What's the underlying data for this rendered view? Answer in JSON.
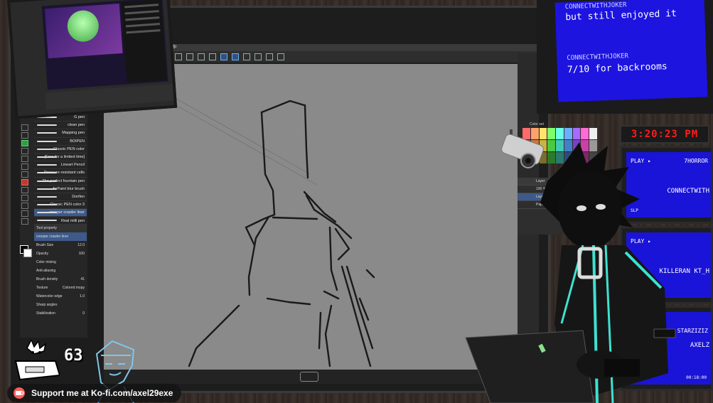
{
  "app": {
    "menu_help": "Help"
  },
  "brushes": [
    {
      "label": "G pen"
    },
    {
      "label": "clean pen"
    },
    {
      "label": "Mapping pen"
    },
    {
      "label": "BOIPEN"
    },
    {
      "label": "Classic PEN color"
    },
    {
      "label": "[Free for a limited time]"
    },
    {
      "label": "Lineart Pencil"
    },
    {
      "label": "Pressure-resistant cells"
    },
    {
      "label": "The perfect fountain pen"
    },
    {
      "label": "AirPaint blur brush"
    },
    {
      "label": "Dorifen"
    },
    {
      "label": "Classic PEN color 3"
    },
    {
      "label": "creeper crawler liner",
      "selected": true
    },
    {
      "label": "Real milli pen"
    }
  ],
  "tool_property": {
    "header": "Tool property",
    "selected_brush": "creeper crawler liner",
    "brush_size_label": "Brush Size",
    "brush_size_value": "12.0",
    "opacity_label": "Opacity",
    "opacity_value": "100",
    "color_mixing_label": "Color mixing",
    "anti_aliasing_label": "Anti-aliasing",
    "brush_density_label": "Brush density",
    "brush_density_value": "41",
    "texture_label": "Texture",
    "texture_value": "Colored mopy",
    "watercolor_label": "Watercolor edge",
    "watercolor_value": "1.0",
    "sharp_angles_label": "Sharp angles",
    "stabilization_label": "Stabilization",
    "stabilization_value": "0"
  },
  "layers": {
    "header": "Layer",
    "items": [
      {
        "label": "100 % Normal"
      },
      {
        "label": "Layer 1",
        "selected": true
      },
      {
        "label": "Paper"
      }
    ]
  },
  "color_set_label": "Color set",
  "chat_monitor": {
    "messages": [
      {
        "user": "CONNECTWITHJOKER",
        "text": "but still enjoyed it"
      },
      {
        "user": "CONNECTWITHJOKER",
        "text": "7/10 for backrooms"
      }
    ]
  },
  "clock": "3:20:23 PM",
  "tvs": [
    {
      "play": "PLAY ▸",
      "title": "7HORROR",
      "name": "CONNECTWITH",
      "level": "SLP"
    },
    {
      "play": "PLAY ▸",
      "title": "",
      "name": "KILLERAN KT_H",
      "level": ""
    },
    {
      "play": "",
      "title": "STARZIZIZ",
      "name": "AXELZ",
      "level": "00:18:00"
    }
  ],
  "overlay": {
    "counter": "63",
    "kofi_text": "Support me at Ko-fi.com/axel29exe"
  },
  "colors": {
    "accent_green": "#2f9e44",
    "tv_blue": "#1a14d8",
    "clock_red": "#ff1c1c",
    "kofi_red": "#ff5e5b",
    "teal": "#3fe0d0"
  },
  "icons": {
    "kofi": "kofi-cup-icon",
    "camera": "security-camera-icon",
    "cat": "cat-keyboard-icon"
  }
}
